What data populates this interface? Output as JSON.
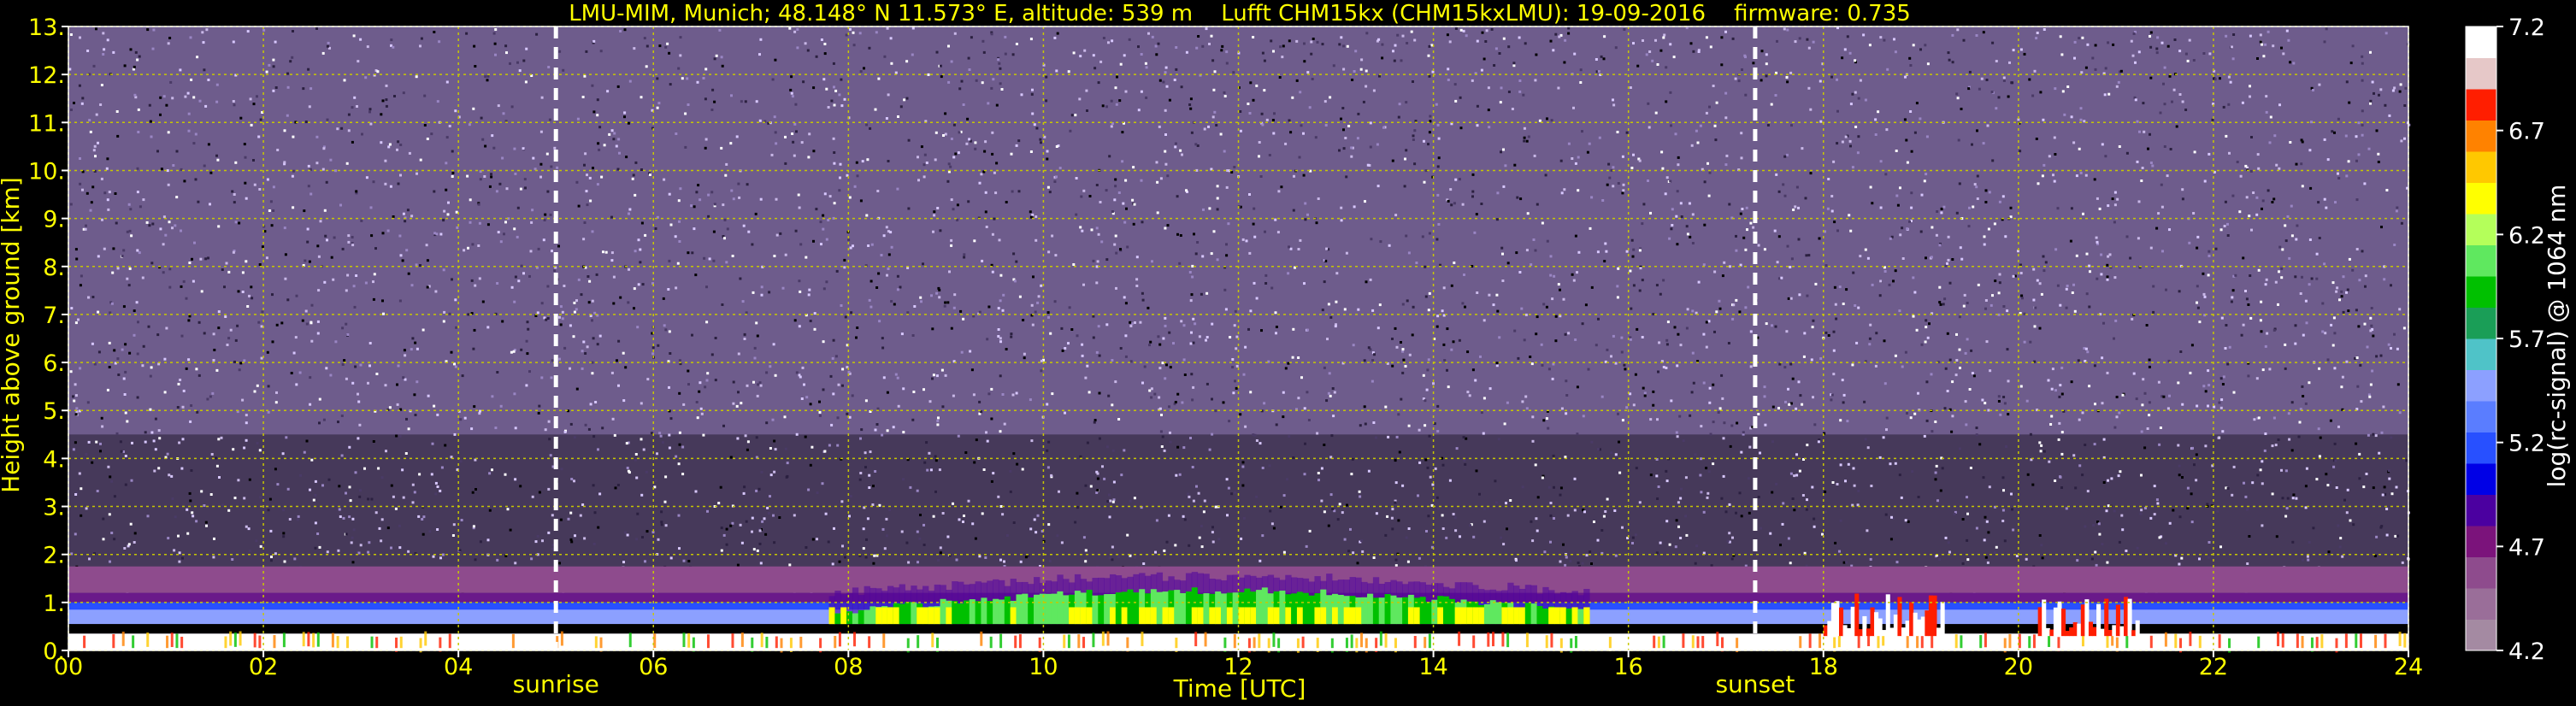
{
  "chart_data": {
    "type": "heatmap",
    "title": "LMU-MIM, Munich; 48.148° N 11.573° E, altitude: 539 m    Lufft CHM15kx (CHM15kxLMU): 19-09-2016    firmware: 0.735",
    "xlabel": "Time [UTC]",
    "ylabel": "Height above ground [km]",
    "colorbar_label": "log(rc-signal) @ 1064 nm",
    "xlim": [
      0,
      24
    ],
    "ylim": [
      0,
      13
    ],
    "x_ticks": [
      "00",
      "02",
      "04",
      "06",
      "08",
      "10",
      "12",
      "14",
      "16",
      "18",
      "20",
      "22",
      "24"
    ],
    "y_ticks": [
      "0.",
      "1.",
      "2.",
      "3.",
      "4.",
      "5.",
      "6.",
      "7.",
      "8.",
      "9.",
      "10.",
      "11.",
      "12.",
      "13."
    ],
    "colorbar_range": [
      4.2,
      7.2
    ],
    "colorbar_ticks": [
      "4.2",
      "4.7",
      "5.2",
      "5.7",
      "6.2",
      "6.7",
      "7.2"
    ],
    "colorbar_colors": [
      "#a48aa2",
      "#9a6e99",
      "#8e4b8d",
      "#7b137b",
      "#4b00a0",
      "#0000e6",
      "#2850ff",
      "#5a7dff",
      "#8ca0ff",
      "#4fc3c8",
      "#1a9e57",
      "#00c000",
      "#5fe85f",
      "#b4ff5a",
      "#ffff00",
      "#ffc800",
      "#ff8200",
      "#ff1e00",
      "#e6c8c8",
      "#ffffff"
    ],
    "grid": true,
    "annotations": [
      {
        "label": "sunrise",
        "x": 5.0
      },
      {
        "label": "sunset",
        "x": 17.3
      }
    ],
    "features": {
      "noise_background": "purple speckle above ~1.2 km",
      "aerosol_layer_top_km": 1.7,
      "cloud_periods": [
        [
          18.0,
          19.2
        ],
        [
          20.2,
          21.2
        ]
      ]
    }
  },
  "colors": {
    "background": "#000000",
    "text": "#ffff00",
    "grid": "#c8c800",
    "colorbar_text": "#ffffff",
    "annotation_line": "#ffffff"
  }
}
